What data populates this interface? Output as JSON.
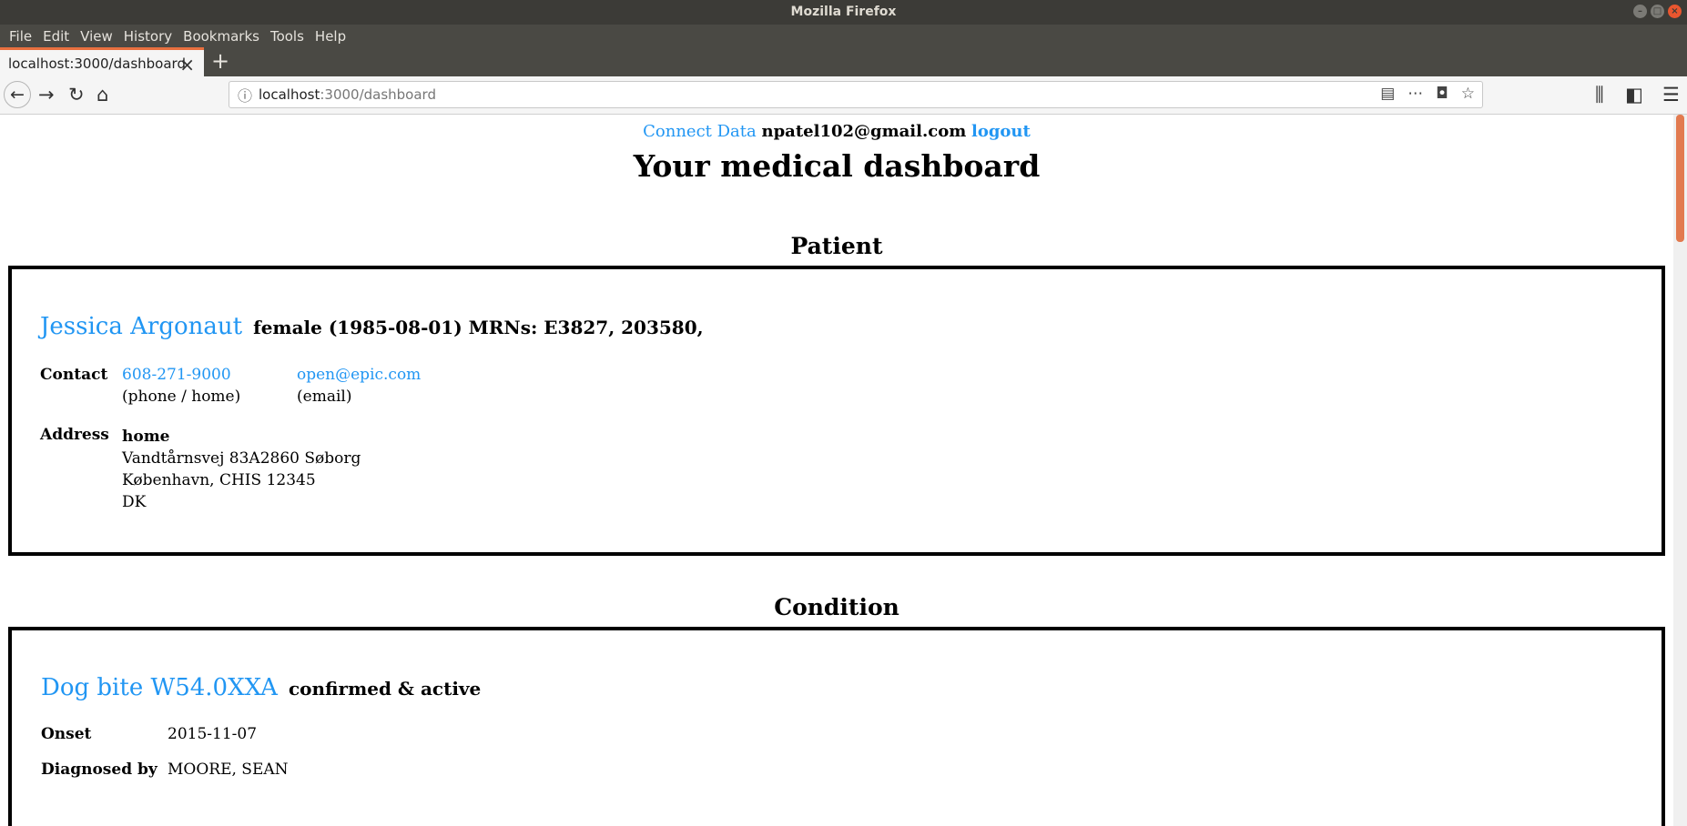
{
  "browser": {
    "window_title": "Mozilla Firefox",
    "menu": [
      "File",
      "Edit",
      "View",
      "History",
      "Bookmarks",
      "Tools",
      "Help"
    ],
    "tab_title": "localhost:3000/dashboard",
    "url_host": "localhost",
    "url_rest": ":3000/dashboard"
  },
  "header": {
    "connect_label": "Connect Data",
    "user_email": "npatel102@gmail.com",
    "logout_label": "logout",
    "page_title": "Your medical dashboard"
  },
  "patient": {
    "section_title": "Patient",
    "name": "Jessica Argonaut",
    "summary": "female (1985-08-01) MRNs: E3827, 203580,",
    "contact_label": "Contact",
    "phone": "608-271-9000",
    "phone_type": "(phone / home)",
    "email": "open@epic.com",
    "email_type": "(email)",
    "address_label": "Address",
    "address_use": "home",
    "address_line1": "Vandtårnsvej 83A2860 Søborg",
    "address_line2": "København, CHIS 12345",
    "address_line3": "DK"
  },
  "condition": {
    "section_title": "Condition",
    "name": "Dog bite W54.0XXA",
    "status": "confirmed & active",
    "onset_label": "Onset",
    "onset_value": "2015-11-07",
    "diagnosed_label": "Diagnosed by",
    "diagnosed_value": "MOORE, SEAN"
  }
}
